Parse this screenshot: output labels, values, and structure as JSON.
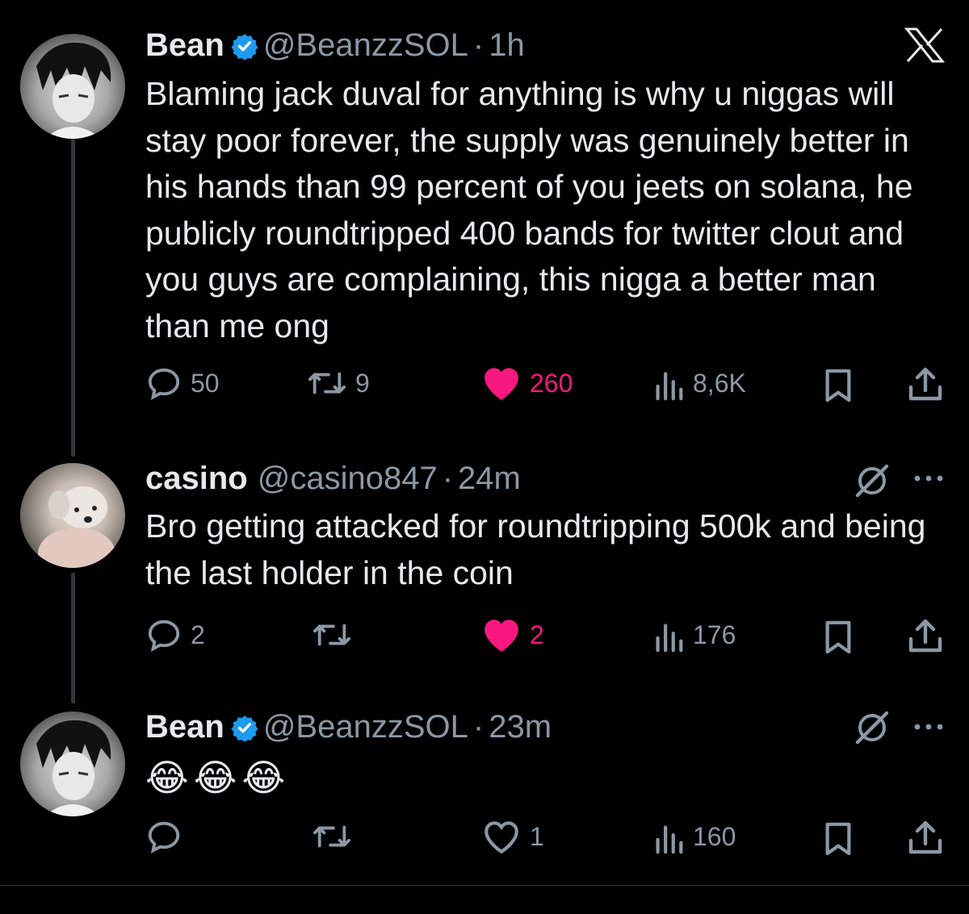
{
  "tweets": [
    {
      "name": "Bean",
      "handle": "@BeanzzSOL",
      "sep": "·",
      "time": "1h",
      "verified": true,
      "text": "Blaming jack duval for anything is why u niggas will stay poor forever, the supply was genuinely better in his hands than 99 percent of you jeets on solana, he publicly roundtripped 400 bands for twitter clout and you guys are complaining, this nigga a better man than me ong",
      "replies": "50",
      "retweets": "9",
      "likes": "260",
      "liked": true,
      "views": "8,6K"
    },
    {
      "name": "casino",
      "handle": "@casino847",
      "sep": "·",
      "time": "24m",
      "verified": false,
      "text": "Bro getting attacked for roundtripping 500k and being the last holder in the coin",
      "replies": "2",
      "retweets": "",
      "likes": "2",
      "liked": true,
      "views": "176"
    },
    {
      "name": "Bean",
      "handle": "@BeanzzSOL",
      "sep": "·",
      "time": "23m",
      "verified": true,
      "text": "😂😂😂",
      "replies": "",
      "retweets": "",
      "likes": "1",
      "liked": false,
      "views": "160"
    }
  ],
  "colors": {
    "background": "#000000",
    "text": "#e7e9ea",
    "muted": "#8b98a5",
    "like": "#f91880",
    "verified": "#1d9bf0"
  },
  "icons": [
    "x-logo-icon",
    "verified-badge-icon",
    "reply-icon",
    "retweet-icon",
    "heart-icon",
    "views-icon",
    "bookmark-icon",
    "share-icon",
    "grok-icon",
    "more-icon"
  ]
}
